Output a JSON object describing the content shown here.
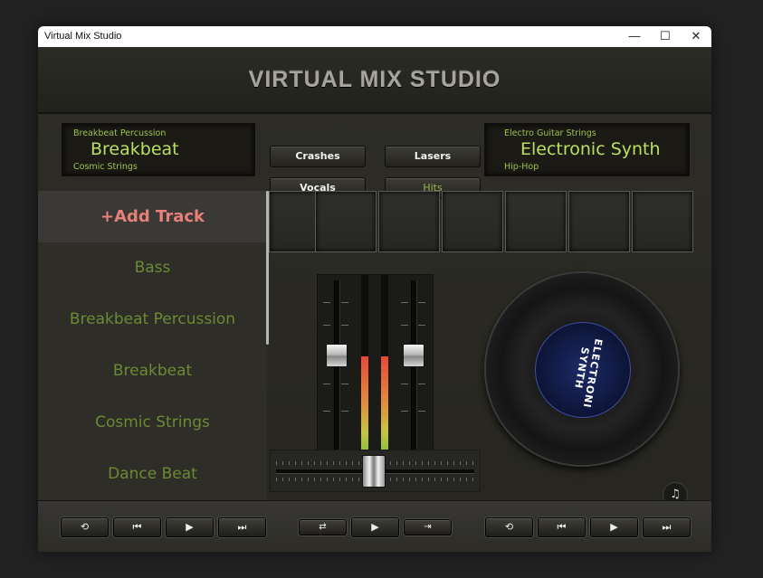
{
  "window": {
    "title": "Virtual Mix Studio",
    "minimize_icon": "minimize-icon",
    "maximize_icon": "maximize-icon",
    "close_icon": "close-icon"
  },
  "header": {
    "title": "VIRTUAL MIX STUDIO"
  },
  "left_deck": {
    "previous_track": "Breakbeat Percussion",
    "current_track": "Breakbeat",
    "next_track": "Cosmic Strings"
  },
  "right_deck": {
    "previous_track": "Electro Guitar Strings",
    "current_track": "Electronic Synth",
    "next_track": "Hip-Hop"
  },
  "effects": [
    {
      "label": "Crashes"
    },
    {
      "label": "Lasers"
    },
    {
      "label": "Vocals"
    },
    {
      "label": "Hits"
    }
  ],
  "sidebar": {
    "add_track_label": "+Add Track",
    "tracks": [
      {
        "label": "Bass"
      },
      {
        "label": "Breakbeat Percussion"
      },
      {
        "label": "Breakbeat"
      },
      {
        "label": "Cosmic Strings"
      },
      {
        "label": "Dance Beat"
      }
    ]
  },
  "turntable": {
    "record_label": "ELECTRONI SYNTH"
  },
  "icons": {
    "music_note": "music-note-icon",
    "repeat": "repeat-icon",
    "skip_previous": "skip-previous-icon",
    "play": "play-icon",
    "skip_next": "skip-next-icon",
    "sync": "sync-icon",
    "fast_forward": "fast-forward-icon"
  },
  "glyphs": {
    "minimize": "—",
    "maximize": "☐",
    "close": "✕",
    "repeat": "⟲",
    "prev": "⏮",
    "play": "▶",
    "next": "⏭",
    "sync": "⇄",
    "forward": "⇥",
    "note": "♫"
  }
}
